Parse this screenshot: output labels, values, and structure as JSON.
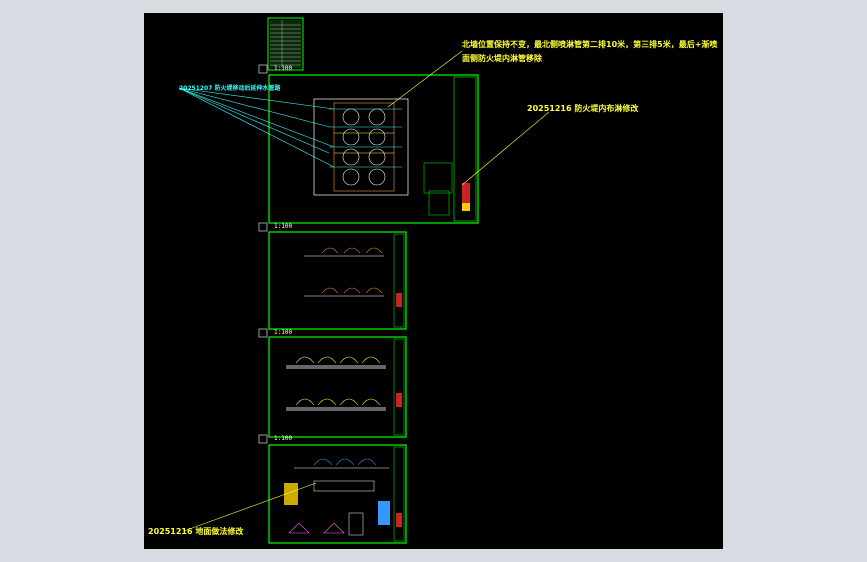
{
  "annotations": {
    "note_top": "北墙位置保持不变，最北侧喷淋管第二排10米，第三排5米，最后+渐喷",
    "note_top_2": "面侧防火堤内淋管移除",
    "note_right": "20251216 防火堤内布淋修改",
    "note_left": "20251207 防火堤移动后延伸水管路",
    "note_bottom": "20251216 地面做法修改"
  },
  "scales": {
    "sheet1": "1:100",
    "sheet2": "1:100",
    "sheet3": "1:100",
    "sheet4": "1:100"
  },
  "colors": {
    "background": "#000000",
    "frame": "#00ff00",
    "note_text": "#ffff33",
    "leader_cyan": "#33ffff",
    "viewport_bg": "#d8dce2"
  }
}
